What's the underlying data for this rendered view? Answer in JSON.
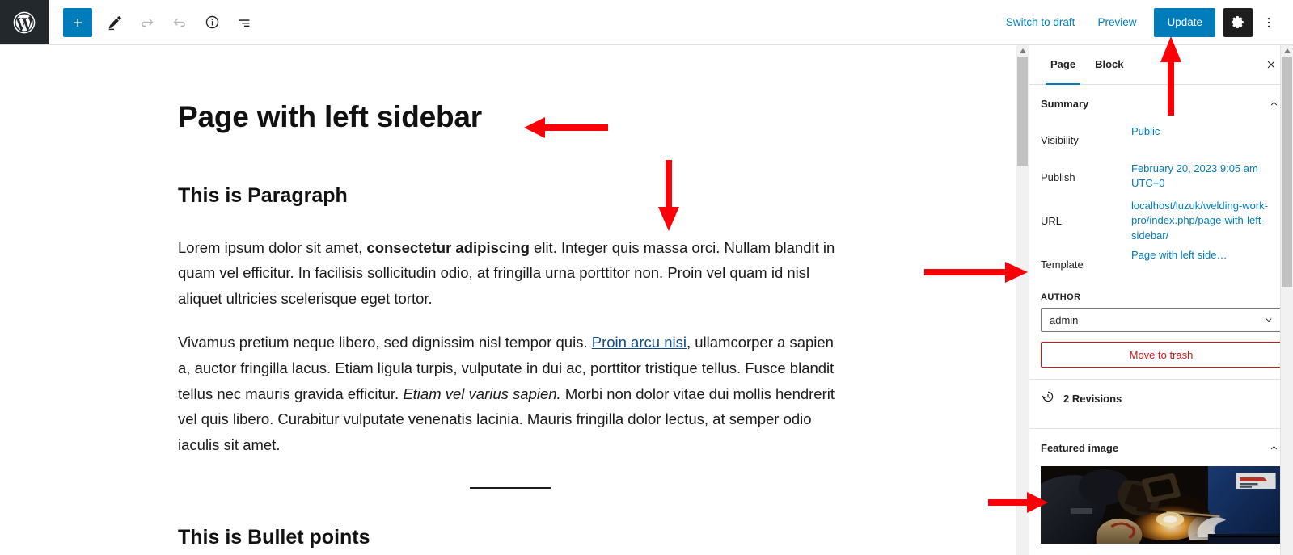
{
  "topbar": {
    "logo_icon": "wordpress-logo-icon",
    "add_block_label": "+",
    "add_block_icon": "plus-icon",
    "edit_icon": "pencil-edit-icon",
    "undo_icon": "undo-arrow-icon",
    "redo_icon": "redo-arrow-icon",
    "details_icon": "info-circle-icon",
    "list_view_icon": "list-view-icon",
    "switch_to_draft_label": "Switch to draft",
    "preview_label": "Preview",
    "update_label": "Update",
    "settings_icon": "gear-icon",
    "options_icon": "kebab-menu-icon",
    "accent_color": "#007cba",
    "logo_bg": "#23282d"
  },
  "editor": {
    "title": "Page with left sidebar",
    "heading_paragraph": "This is Paragraph",
    "paragraph_1": {
      "part1": "Lorem ipsum dolor sit amet, ",
      "bold": "consectetur adipiscing",
      "part2": " elit. Integer quis massa orci. Nullam blandit in quam vel efficitur. In facilisis sollicitudin odio, at fringilla urna porttitor non. Proin vel quam id nisl aliquet ultricies scelerisque eget tortor."
    },
    "paragraph_2": {
      "part1": "Vivamus pretium neque libero, sed dignissim nisl tempor quis. ",
      "link": "Proin arcu nisi",
      "part2": ", ullamcorper a sapien a, auctor fringilla lacus. Etiam ligula turpis, vulputate in dui ac, porttitor tristique tellus. Fusce blandit tellus nec mauris gravida efficitur. ",
      "italic": "Etiam vel varius sapien.",
      "part3": " Morbi non dolor vitae dui mollis hendrerit vel quis libero. Curabitur vulputate venenatis lacinia. Mauris fringilla dolor lectus, at semper odio iaculis sit amet."
    },
    "separator_icon": "horizontal-rule-separator",
    "heading_bullets": "This is Bullet points"
  },
  "sidebar": {
    "tabs": [
      {
        "label": "Page",
        "active": true
      },
      {
        "label": "Block",
        "active": false
      }
    ],
    "close_icon": "close-x-icon",
    "summary": {
      "title": "Summary",
      "collapse_icon": "chevron-up-icon",
      "rows": [
        {
          "label": "Visibility",
          "value": "Public"
        },
        {
          "label": "Publish",
          "value": "February 20, 2023 9:05 am UTC+0"
        },
        {
          "label": "URL",
          "value": "localhost/luzuk/welding-work-pro/index.php/page-with-left-sidebar/"
        },
        {
          "label": "Template",
          "value": "Page with left side…"
        }
      ]
    },
    "author": {
      "label": "AUTHOR",
      "selected": "admin",
      "caret_icon": "chevron-down-icon"
    },
    "move_to_trash_label": "Move to trash",
    "trash_color": "#cc1818",
    "revisions": {
      "icon": "clock-revisions-icon",
      "label": "2 Revisions"
    },
    "featured_image": {
      "title": "Featured image",
      "collapse_icon": "chevron-up-icon",
      "image_alt": "welder-working-with-torch-sparks-photo"
    },
    "scrollbar_icon": "scrollbar-thumb"
  },
  "annotations": {
    "color": "#fb0007",
    "arrows": [
      {
        "name": "arrow-pointing-to-page-title",
        "direction": "left"
      },
      {
        "name": "arrow-pointing-to-paragraph-content",
        "direction": "down"
      },
      {
        "name": "arrow-pointing-to-update-button",
        "direction": "up"
      },
      {
        "name": "arrow-pointing-to-template-row",
        "direction": "right"
      },
      {
        "name": "arrow-pointing-to-featured-image",
        "direction": "right"
      }
    ]
  }
}
